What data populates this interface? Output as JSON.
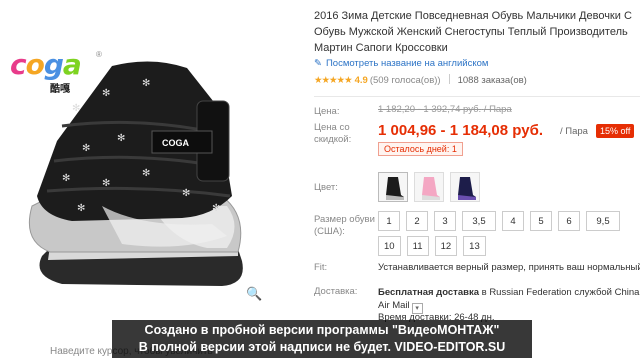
{
  "logo": {
    "text_parts": [
      "c",
      "o",
      "g",
      "a"
    ],
    "registered": "®",
    "sub": "酷嘎"
  },
  "product": {
    "title_line1": "2016 Зима Детские Повседневная Обувь Мальчики Девочки С",
    "title_line2": "Обувь Мужской Женский Снегоступы Теплый Производитель",
    "title_line3": "Мартин Сапоги Кроссовки",
    "translate_link": "Посмотреть название на английском",
    "stars": "★★★★★",
    "rating": "4.9",
    "votes": "(509 голоса(ов))",
    "orders": "1088 заказа(ов)"
  },
  "price": {
    "label": "Цена:",
    "old": "1 182,20 - 1 392,74 руб.",
    "old_unit": "/ Пара",
    "discount_label_1": "Цена со",
    "discount_label_2": "скидкой:",
    "new": "1 004,96 - 1 184,08 руб.",
    "unit": "/ Пара",
    "discount_badge": "15% off",
    "days_left": "Осталось дней: 1"
  },
  "options": {
    "color_label": "Цвет:",
    "colors": [
      "black-silver",
      "pink",
      "navy-purple"
    ],
    "size_label_1": "Размер обуви",
    "size_label_2": "(США):",
    "sizes": [
      "1",
      "2",
      "3",
      "3,5",
      "4",
      "5",
      "6",
      "9,5",
      "10",
      "11",
      "12",
      "13"
    ]
  },
  "fit": {
    "label": "Fit:",
    "text": "Устанавливается верный размер, принять ваш нормальный"
  },
  "shipping": {
    "label": "Доставка:",
    "text_bold": "Бесплатная доставка",
    "text_rest": " в Russian Federation службой China",
    "line2": "Air Mail",
    "time": "Время доставки: 26-48 дн."
  },
  "ui": {
    "hover_hint": "Наведите курсор, чтобы увеличить"
  },
  "watermark": {
    "line1": "Создано в пробной версии программы \"ВидеоМОНТАЖ\"",
    "line2": "В полной версии этой надписи не будет. VIDEO-EDITOR.SU"
  },
  "colors": {
    "price_red": "#e62e04",
    "star_yellow": "#f5a623",
    "link_blue": "#2d74c6"
  }
}
